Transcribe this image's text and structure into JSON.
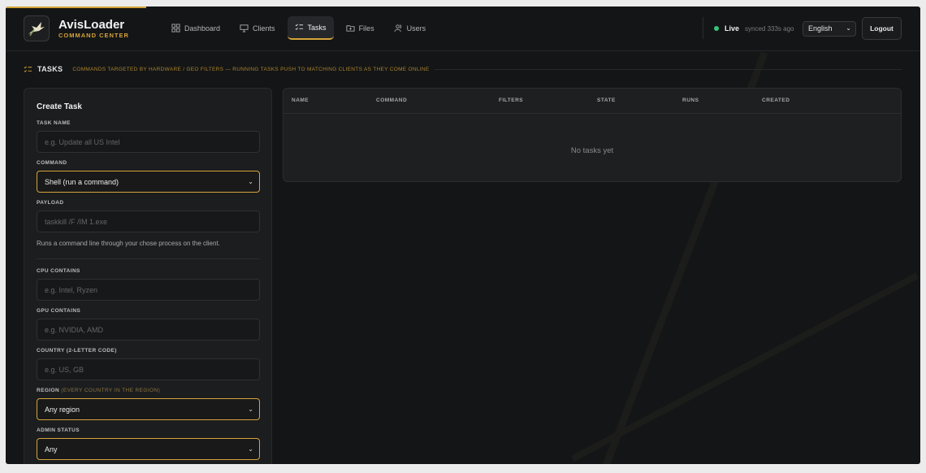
{
  "brand": {
    "name": "AvisLoader",
    "subtitle": "COMMAND CENTER"
  },
  "nav": [
    {
      "label": "Dashboard",
      "icon": "grid-icon",
      "active": false
    },
    {
      "label": "Clients",
      "icon": "monitor-icon",
      "active": false
    },
    {
      "label": "Tasks",
      "icon": "tasks-icon",
      "active": true
    },
    {
      "label": "Files",
      "icon": "folder-icon",
      "active": false
    },
    {
      "label": "Users",
      "icon": "users-icon",
      "active": false
    }
  ],
  "status": {
    "live_label": "Live",
    "sync_text": "synced 333s ago",
    "live_color": "#35c37a"
  },
  "language": {
    "selected": "English"
  },
  "logout_label": "Logout",
  "section": {
    "title": "TASKS",
    "description": "COMMANDS TARGETED BY HARDWARE / GEO FILTERS — RUNNING TASKS PUSH TO MATCHING CLIENTS AS THEY COME ONLINE"
  },
  "form": {
    "title": "Create Task",
    "task_name": {
      "label": "TASK NAME",
      "placeholder": "e.g. Update all US Intel"
    },
    "command": {
      "label": "COMMAND",
      "value": "Shell (run a command)"
    },
    "payload": {
      "label": "PAYLOAD",
      "placeholder": "taskkill /F /IM 1.exe"
    },
    "help_text": "Runs a command line through your chose process on the client.",
    "cpu": {
      "label": "CPU CONTAINS",
      "placeholder": "e.g. Intel, Ryzen"
    },
    "gpu": {
      "label": "GPU CONTAINS",
      "placeholder": "e.g. NVIDIA, AMD"
    },
    "country": {
      "label": "COUNTRY (2-LETTER CODE)",
      "placeholder": "e.g. US, GB"
    },
    "region": {
      "label": "REGION",
      "hint": "(EVERY COUNTRY IN THE REGION)",
      "value": "Any region"
    },
    "admin": {
      "label": "ADMIN STATUS",
      "value": "Any"
    }
  },
  "table": {
    "columns": [
      "NAME",
      "COMMAND",
      "FILTERS",
      "STATE",
      "RUNS",
      "CREATED"
    ],
    "empty_text": "No tasks yet"
  },
  "colors": {
    "accent": "#d4a43a",
    "background": "#141516",
    "panel": "#1c1d1f"
  }
}
